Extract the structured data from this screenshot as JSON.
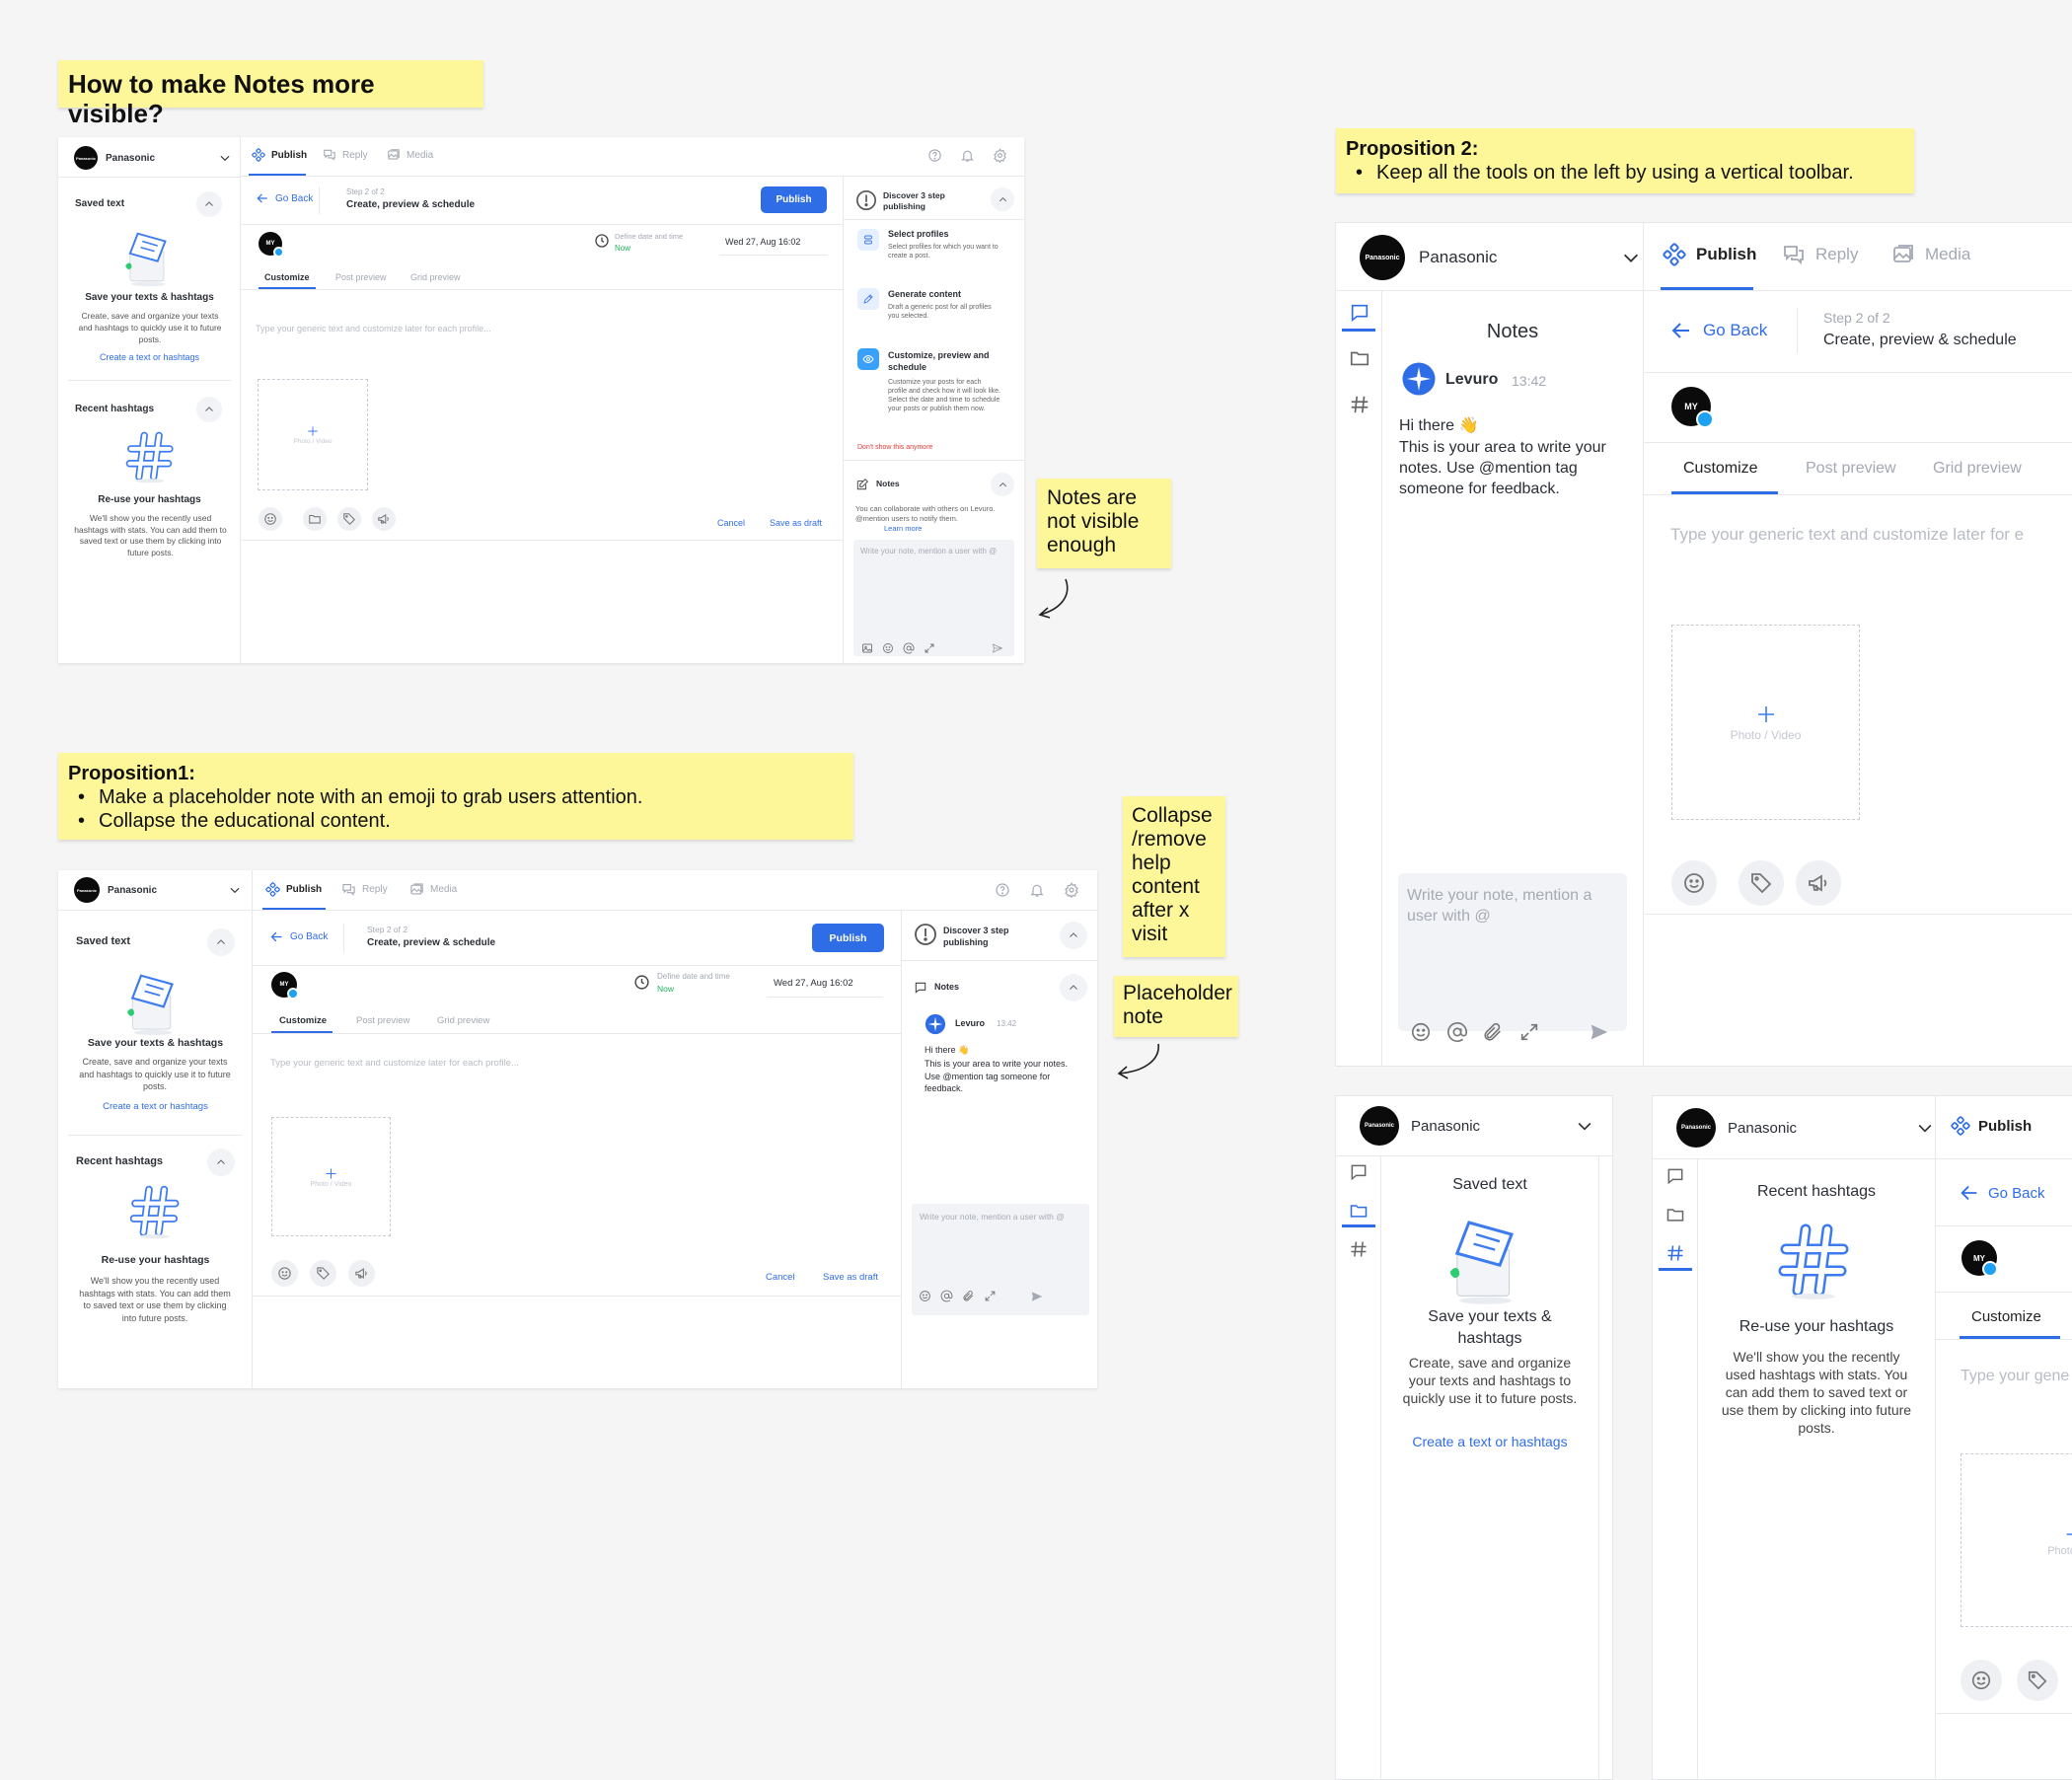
{
  "colors": {
    "accent": "#2f6de6",
    "sticky": "#fdf79a",
    "danger": "#e53935",
    "now": "#1fb35e"
  },
  "stickies": {
    "title": "How to make Notes more visible?",
    "notes_not_visible": "Notes are not visible enough",
    "prop1_title": "Proposition1:",
    "prop1_bullets": [
      "Make a placeholder note with an emoji to grab users attention.",
      "Collapse the educational content."
    ],
    "collapse": "Collapse /remove help content after x visit",
    "placeholder": "Placeholder note",
    "prop2_title": "Proposition 2:",
    "prop2_bullets": [
      "Keep all the tools on the left by using a vertical toolbar."
    ]
  },
  "app": {
    "brand": "Panasonic",
    "tabs": [
      "Publish",
      "Reply",
      "Media"
    ],
    "go_back": "Go Back",
    "step": "Step 2 of 2",
    "step_title": "Create, preview & schedule",
    "publish_btn": "Publish",
    "define_date": "Define date and time",
    "now": "Now",
    "date_value": "Wed 27, Aug 16:02",
    "subtabs": [
      "Customize",
      "Post preview",
      "Grid preview"
    ],
    "placeholder": "Type your generic text and customize later for each profile...",
    "photo_video": "Photo / Video",
    "cancel": "Cancel",
    "save_draft": "Save as draft",
    "saved_text_header": "Saved text",
    "saved_text_title": "Save your texts & hashtags",
    "saved_text_desc": "Create, save and organize your texts and hashtags to quickly use it to future posts.",
    "saved_text_link": "Create a text or hashtags",
    "hashtags_header": "Recent hashtags",
    "hashtags_title": "Re-use your hashtags",
    "hashtags_desc": "We'll show you the recently used hashtags with stats.  You can add them to saved text or use them by clicking into future posts.",
    "discover": "Discover 3 step publishing",
    "steps": [
      {
        "title": "Select profiles",
        "desc": "Select profiles for which you want to create a post."
      },
      {
        "title": "Generate content",
        "desc": "Draft a generic post for all profiles you selected."
      },
      {
        "title": "Customize, preview and schedule",
        "desc": "Customize your posts for each profile and check how it will look like. Select the date and time to schedule your posts or publish them now."
      }
    ],
    "dont_show": "Don't show this anymore",
    "notes": "Notes",
    "notes_desc": "You can collaborate with others on Levuro. @mention users to notify them.",
    "learn_more": "Learn more",
    "note_input": "Write your note, mention a user with @",
    "note_author": "Levuro",
    "note_time": "13:42",
    "note_hi": "Hi there 👋",
    "note_body": "This is your area to write your notes. Use @mention tag someone for feedback.",
    "avatar_short": "MY"
  },
  "prop2": {
    "step": "Step 2 of 2",
    "step_title": "Create, preview & schedule",
    "saved_text_title": "Save your texts & hashtags",
    "saved_text_desc": "Create, save and organize your texts and hashtags to quickly use it to future posts.",
    "hashtags_desc": "We'll show you the recently used hashtags with stats. You can add them to saved text or use them by clicking into future posts.",
    "placeholder_cut": "Type your generic text and customize later for e",
    "placeholder_cut2": "Type your gene",
    "photo_cut": "Photo / Vid"
  }
}
